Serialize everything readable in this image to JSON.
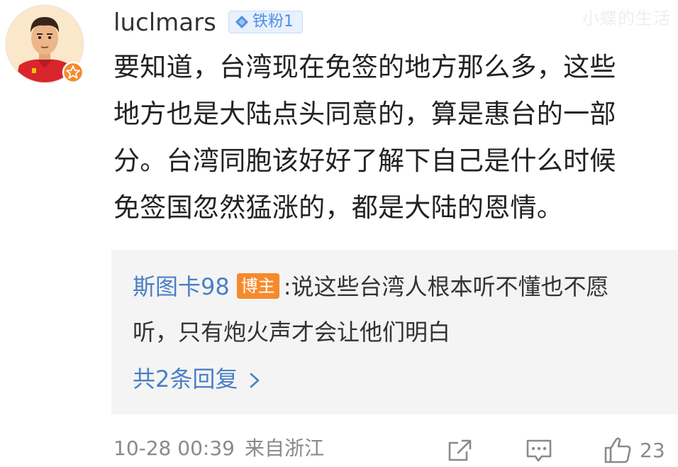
{
  "watermark": "小蝶的生活",
  "comment": {
    "username": "luclmars",
    "fan_badge": "铁粉1",
    "avatar_icon": "avatar-footballer-icon",
    "lines": [
      "要知道，台湾现在免签的地方那么多，这些",
      "地方也是大陆点头同意的，算是惠台的一部",
      "分。台湾同胞该好好了解下自己是什么时候",
      "免签国忽然猛涨的，都是大陆的恩情。"
    ],
    "timestamp": "10-28 00:39",
    "location": "来自浙江",
    "like_count": "23"
  },
  "reply": {
    "author": "斯图卡98",
    "host_badge": "博主",
    "separator": ":",
    "text_line1": "说这些台湾人根本听不懂也不愿",
    "text_line2": "听，只有炮火声才会让他们明白",
    "more_label": "共2条回复",
    "more_icon": "chevron-right-icon"
  },
  "colors": {
    "link_blue": "#4b7fc6",
    "host_badge_orange": "#f58a2d",
    "fan_badge_bg": "#e8f1fd",
    "fan_badge_text": "#4d8fe6",
    "reply_bg": "#f4f4f4",
    "meta_gray": "#8a8a8a"
  }
}
